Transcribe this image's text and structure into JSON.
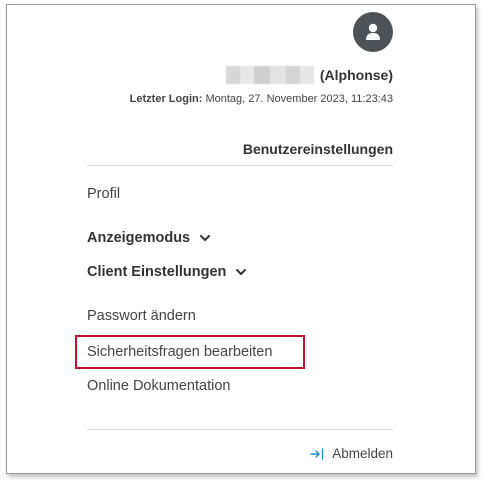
{
  "user": {
    "display_name_suffix": "(Alphonse)",
    "last_login_label": "Letzter Login:",
    "last_login_value": "Montag, 27. November 2023, 11:23:43"
  },
  "menu": {
    "section_title": "Benutzereinstellungen",
    "profile": "Profil",
    "display_mode": "Anzeigemodus",
    "client_settings": "Client Einstellungen",
    "change_password": "Passwort ändern",
    "edit_security_questions": "Sicherheitsfragen bearbeiten",
    "online_docs": "Online Dokumentation"
  },
  "footer": {
    "logout": "Abmelden"
  },
  "colors": {
    "highlight": "#c3122f",
    "avatar_bg": "#4d5257",
    "logout_icon": "#2b8fc7"
  },
  "icons": {
    "avatar": "user-icon",
    "chevrons": "chevron-down-icon",
    "logout": "logout-arrow-icon"
  }
}
